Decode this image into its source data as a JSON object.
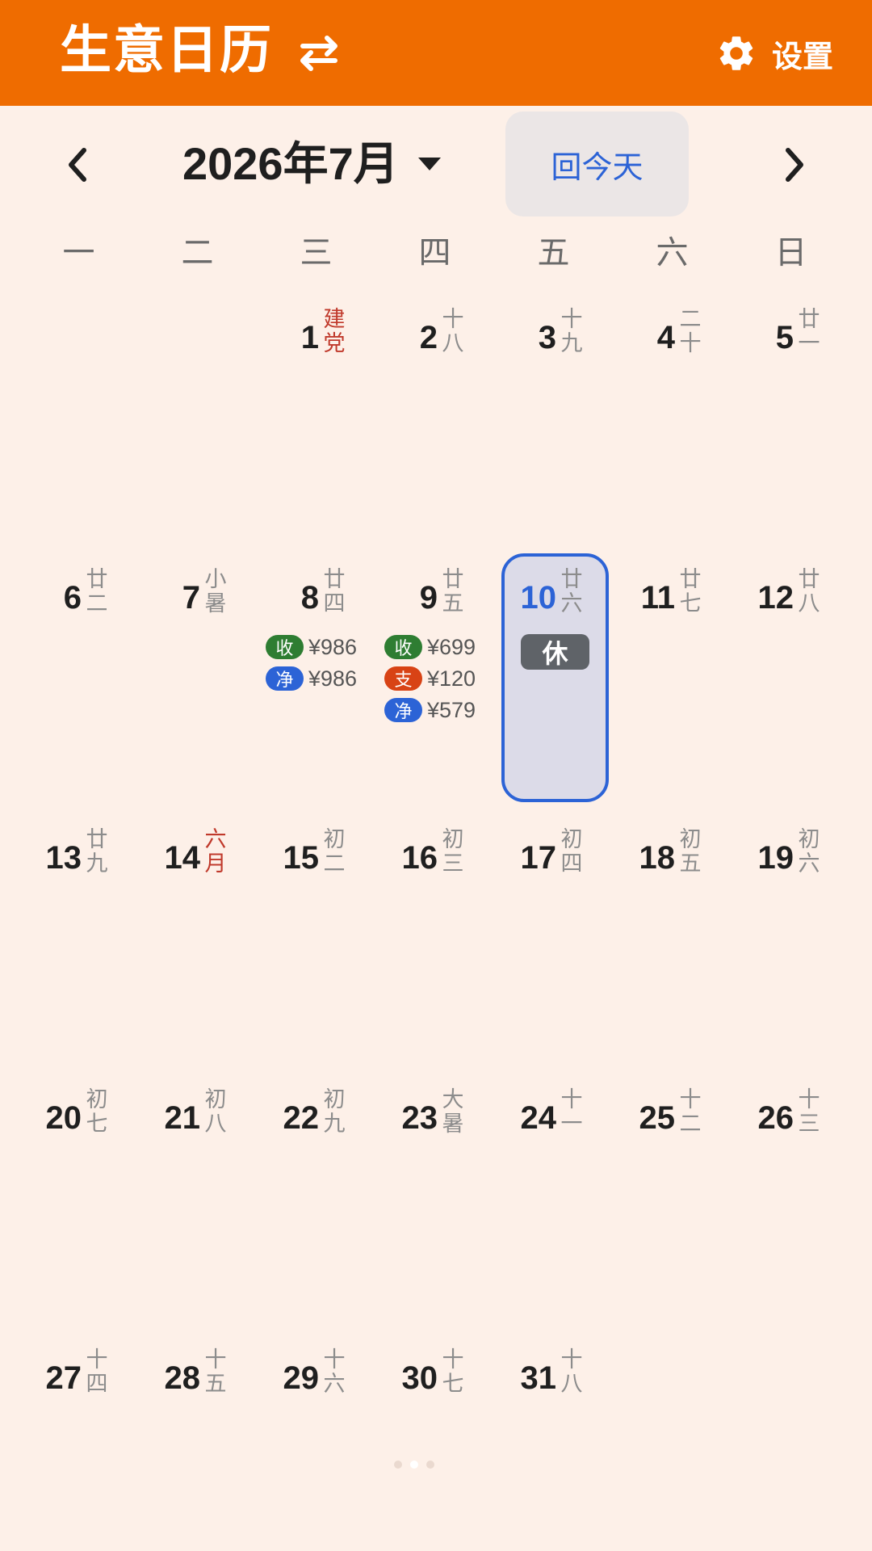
{
  "app": {
    "title": "生意日历",
    "settings_label": "设置",
    "icons": {
      "swap": "swap-arrows-icon",
      "settings": "gear-icon"
    },
    "colors": {
      "header": "#ef6c00",
      "background": "#fdf0e8",
      "accent_blue": "#2c63d6",
      "income": "#2e7d32",
      "expense": "#d84315"
    }
  },
  "nav": {
    "month_label": "2026年7月",
    "today_label": "回今天",
    "prev_icon": "chevron-left-icon",
    "next_icon": "chevron-right-icon",
    "dropdown_icon": "caret-down-icon"
  },
  "weekdays": [
    "一",
    "二",
    "三",
    "四",
    "五",
    "六",
    "日"
  ],
  "days": [
    {
      "num": "1",
      "lunar": [
        "建",
        "党"
      ],
      "lunar_red": true
    },
    {
      "num": "2",
      "lunar": [
        "十",
        "八"
      ]
    },
    {
      "num": "3",
      "lunar": [
        "十",
        "九"
      ]
    },
    {
      "num": "4",
      "lunar": [
        "二",
        "十"
      ]
    },
    {
      "num": "5",
      "lunar": [
        "廿",
        "一"
      ]
    },
    {
      "num": "6",
      "lunar": [
        "廿",
        "二"
      ]
    },
    {
      "num": "7",
      "lunar": [
        "小",
        "暑"
      ]
    },
    {
      "num": "8",
      "lunar": [
        "廿",
        "四"
      ]
    },
    {
      "num": "9",
      "lunar": [
        "廿",
        "五"
      ]
    },
    {
      "num": "10",
      "lunar": [
        "廿",
        "六"
      ]
    },
    {
      "num": "11",
      "lunar": [
        "廿",
        "七"
      ]
    },
    {
      "num": "12",
      "lunar": [
        "廿",
        "八"
      ]
    },
    {
      "num": "13",
      "lunar": [
        "廿",
        "九"
      ]
    },
    {
      "num": "14",
      "lunar": [
        "六",
        "月"
      ],
      "lunar_red": true
    },
    {
      "num": "15",
      "lunar": [
        "初",
        "二"
      ]
    },
    {
      "num": "16",
      "lunar": [
        "初",
        "三"
      ]
    },
    {
      "num": "17",
      "lunar": [
        "初",
        "四"
      ]
    },
    {
      "num": "18",
      "lunar": [
        "初",
        "五"
      ]
    },
    {
      "num": "19",
      "lunar": [
        "初",
        "六"
      ]
    },
    {
      "num": "20",
      "lunar": [
        "初",
        "七"
      ]
    },
    {
      "num": "21",
      "lunar": [
        "初",
        "八"
      ]
    },
    {
      "num": "22",
      "lunar": [
        "初",
        "九"
      ]
    },
    {
      "num": "23",
      "lunar": [
        "大",
        "暑"
      ]
    },
    {
      "num": "24",
      "lunar": [
        "十",
        "一"
      ]
    },
    {
      "num": "25",
      "lunar": [
        "十",
        "二"
      ]
    },
    {
      "num": "26",
      "lunar": [
        "十",
        "三"
      ]
    },
    {
      "num": "27",
      "lunar": [
        "十",
        "四"
      ]
    },
    {
      "num": "28",
      "lunar": [
        "十",
        "五"
      ]
    },
    {
      "num": "29",
      "lunar": [
        "十",
        "六"
      ]
    },
    {
      "num": "30",
      "lunar": [
        "十",
        "七"
      ]
    },
    {
      "num": "31",
      "lunar": [
        "十",
        "八"
      ]
    }
  ],
  "selected_day": {
    "num": "10",
    "status": "休"
  },
  "entries": {
    "day8": [
      {
        "tag": "收",
        "amount": "¥986"
      },
      {
        "tag": "净",
        "amount": "¥986"
      }
    ],
    "day9": [
      {
        "tag": "收",
        "amount": "¥699"
      },
      {
        "tag": "支",
        "amount": "¥120"
      },
      {
        "tag": "净",
        "amount": "¥579"
      }
    ]
  },
  "pager": {
    "count": 3,
    "active": 1
  }
}
